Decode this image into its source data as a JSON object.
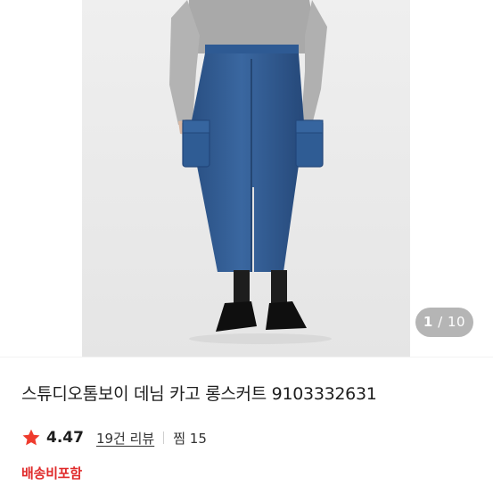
{
  "gallery": {
    "current_index": "1",
    "separator": "/",
    "total": "10"
  },
  "product": {
    "title": "스튜디오톰보이 데님 카고 롱스커트 9103332631",
    "rating_icon": "star-icon",
    "rating": "4.47",
    "reviews_link": "19건 리뷰",
    "favorites": "찜 15",
    "shipping": "배송비포함"
  },
  "colors": {
    "accent_red": "#e02a2a",
    "denim": "#2e5a93",
    "star": "#ef3b2d"
  }
}
